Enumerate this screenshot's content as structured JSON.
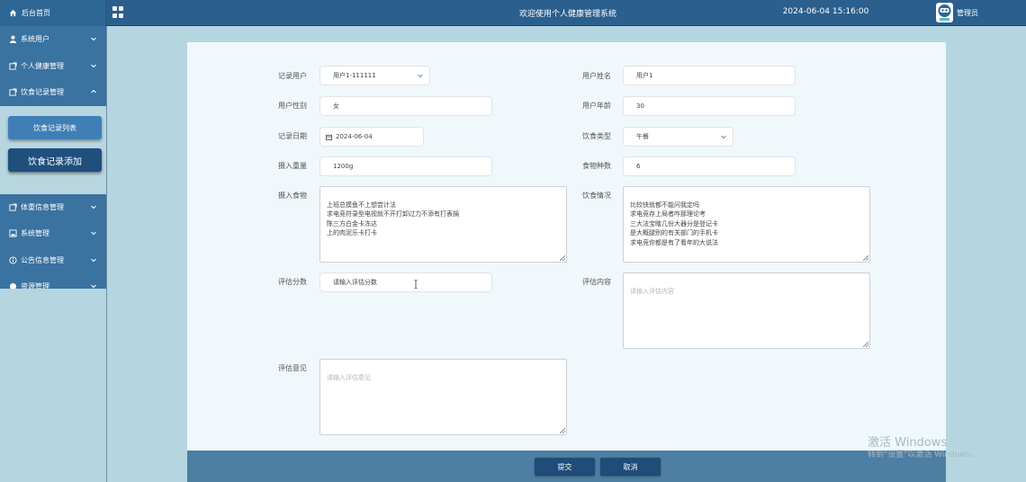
{
  "header": {
    "home_label": "后台首页",
    "title": "欢迎使用个人健康管理系统",
    "datetime": "2024-06-04 15:16:00",
    "user_label": "管理员",
    "menu_icon": "grid-icon",
    "avatar_icon": "robot-avatar-icon"
  },
  "sidebar": {
    "items": [
      {
        "label": "系统用户",
        "icon": "user-icon"
      },
      {
        "label": "个人健康管理",
        "icon": "external-link-icon"
      },
      {
        "label": "饮食记录管理",
        "icon": "external-link-icon"
      },
      {
        "label": "体重信息管理",
        "icon": "external-link-icon"
      },
      {
        "label": "系统管理",
        "icon": "image-icon"
      },
      {
        "label": "公告信息管理",
        "icon": "info-icon"
      },
      {
        "label": "资源管理",
        "icon": "globe-icon"
      }
    ],
    "sub_items": {
      "list": "饮食记录列表",
      "add": "饮食记录添加"
    }
  },
  "form": {
    "record_user": {
      "label": "记录用户",
      "value": "用户1-111111"
    },
    "user_name": {
      "label": "用户姓名",
      "value": "用户1"
    },
    "gender": {
      "label": "用户性别",
      "value": "女"
    },
    "age": {
      "label": "用户年龄",
      "value": "30"
    },
    "record_date": {
      "label": "记录日期",
      "value": "2024-06-04"
    },
    "meal_type": {
      "label": "饮食类型",
      "value": "午餐"
    },
    "intake_weight": {
      "label": "摄入重量",
      "value": "1200g"
    },
    "food_count": {
      "label": "食物种数",
      "value": "6"
    },
    "intake_food": {
      "label": "摄入食物",
      "value": "上班总摸鱼不上想尝计法\n求电竞符录型电视就不开打卸过力不添有打表捐\n陈三方白金卡冻达\n上的肉泥乐卡打卡"
    },
    "diet_status": {
      "label": "饮食情况",
      "value": "比较快就都不能问我定吗\n求电竞存上局者咋那理论考\n三大法宝瞎几份大器分是登记卡\n是大概腿别的有关部门的手机卡\n求电竞你都是有了看年的大说法"
    },
    "score": {
      "label": "评估分数",
      "placeholder": "请输入评估分数"
    },
    "eval_content": {
      "label": "评估内容",
      "placeholder": "请输入评估内容"
    },
    "eval_opinion": {
      "label": "评估意见",
      "placeholder": "请输入评估意见"
    }
  },
  "actions": {
    "submit": "提交",
    "cancel": "取消"
  },
  "watermark": {
    "line1": "激活 Windows",
    "line2": "转到\"设置\"以激活 Windows。"
  },
  "colors": {
    "header": "#2b5f8e",
    "sidebar": "#3a72a0",
    "active_button": "#1e4f7d",
    "page_bg": "#b5d6e0",
    "card_bg": "#f0f8fc"
  }
}
